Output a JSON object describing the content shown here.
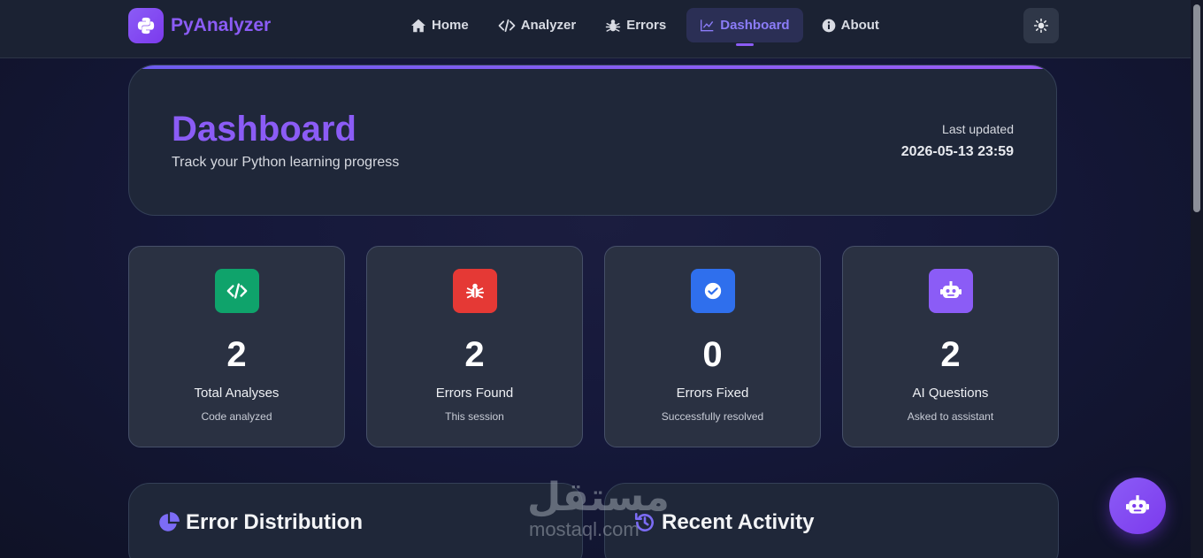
{
  "brand": {
    "name": "PyAnalyzer",
    "logo_icon": "python-logo-icon"
  },
  "nav": {
    "items": [
      {
        "label": "Home",
        "icon": "home-icon"
      },
      {
        "label": "Analyzer",
        "icon": "code-icon"
      },
      {
        "label": "Errors",
        "icon": "bug-icon"
      },
      {
        "label": "Dashboard",
        "icon": "chart-line-icon",
        "active": true
      },
      {
        "label": "About",
        "icon": "info-icon"
      }
    ],
    "theme_toggle_icon": "sun-icon"
  },
  "header": {
    "title": "Dashboard",
    "subtitle": "Track your Python learning progress",
    "updated_label": "Last updated",
    "updated_value": "2026-05-13 23:59"
  },
  "stats": [
    {
      "value": "2",
      "label": "Total Analyses",
      "sub": "Code analyzed",
      "icon": "code-icon",
      "color": "#0fa36b"
    },
    {
      "value": "2",
      "label": "Errors Found",
      "sub": "This session",
      "icon": "bug-icon",
      "color": "#e53935"
    },
    {
      "value": "0",
      "label": "Errors Fixed",
      "sub": "Successfully resolved",
      "icon": "check-circle-icon",
      "color": "#2f6fed"
    },
    {
      "value": "2",
      "label": "AI Questions",
      "sub": "Asked to assistant",
      "icon": "robot-icon",
      "color": "#8b5cf6"
    }
  ],
  "panels": {
    "distribution_title": "Error Distribution",
    "activity_title": "Recent Activity"
  },
  "watermark": {
    "arabic": "مستقل",
    "latin": "mostaql.com"
  },
  "colors": {
    "accent": "#8b5cf6",
    "background": "#15183a",
    "card": "#2a3142"
  }
}
